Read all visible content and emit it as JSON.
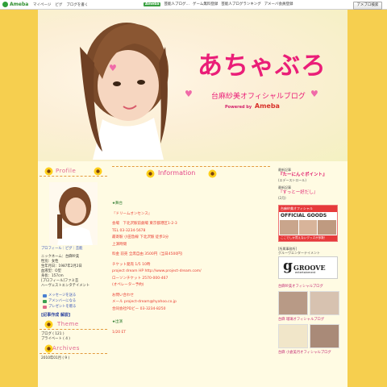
{
  "topbar": {
    "brand": "Ameba",
    "nav": [
      "マイページ",
      "ピグ",
      "ブログを書く"
    ],
    "promo_badge": "Ameba",
    "promo_items": [
      "芸能人ブログ…",
      "ゲーム無料登録",
      "芸能人ブログランキング",
      "アメーバ会員登録"
    ],
    "search_button": "アメブロ検索"
  },
  "header": {
    "title": "あちゃぶろ",
    "subtitle": "台麻紗美オフィシャルブログ",
    "powered_by": "Powered by",
    "powered_brand": "Ameba"
  },
  "left": {
    "profile_heading": "Profile",
    "profile_link": "プロフィール｜ピグ｜芸能",
    "profile_lines": [
      "ニックネーム：台麻紗美",
      "性別：女性",
      "生年月日：1987年2月2日",
      "血液型：O型",
      "身長：157cm",
      "[プロフィール]ファミ芸",
      "ハーヴェストエンタテイメント"
    ],
    "links": [
      "メッセージを送る",
      "アメンバーになる",
      "プレゼントを贈る"
    ],
    "bold_link": "[記事作成 解説]",
    "theme_heading": "Theme",
    "theme_lines": [
      "ブログ ( 121 )",
      "プライベート ( 4 )"
    ],
    "archives_heading": "Archives",
    "archive_lines": [
      "2010年01月 ( 9 )"
    ]
  },
  "main": {
    "info_heading": "Information",
    "lines": [
      "★舞台",
      "『ドリームオンセンス』",
      "会場　下北沢駅前劇場 東京都港区1-2-3",
      "TEL 03-3234-5678",
      "最寄駅 小田急線 下北沢駅 徒歩3分",
      "上演時間",
      "料金 前売 全席自由 3500円（当日4500円）",
      "チケット発売 1/5 10時",
      "project dream HP http://www.project-dream.com/",
      "ローソンチケット 2570-000-467",
      "(オペレーター予約)",
      "お問い合わせ",
      "メール project-dream@hyahoo.co.jp",
      "合同会社PDビー 03-3234-8250",
      "★出演",
      "1/20 ET"
    ]
  },
  "right": {
    "label1": "最新記事",
    "pink1": "『たーにんぐポイント』",
    "small1": "(エデーストロール)",
    "label2": "最新記事",
    "pink2": "『すっとー好だし』",
    "small2": "(2月)",
    "banner_top": "台麻紗美オフィシャル",
    "banner_mid": "OFFICIAL GOODS",
    "banner_bottom": "ここでしか買えないグッズが多数！",
    "agency_label": "[所属事務所]",
    "agency_sub": "グルーヴエンターテイメント",
    "groove_g": "g",
    "groove_text": "GROOVE",
    "groove_sub": "entertainment",
    "link1": "台麻紗美オフィシャルブログ",
    "link2": "台麻 瑠璃オフィシャルブログ",
    "link3": "台麻 小倉美月オフィシャルブログ"
  }
}
